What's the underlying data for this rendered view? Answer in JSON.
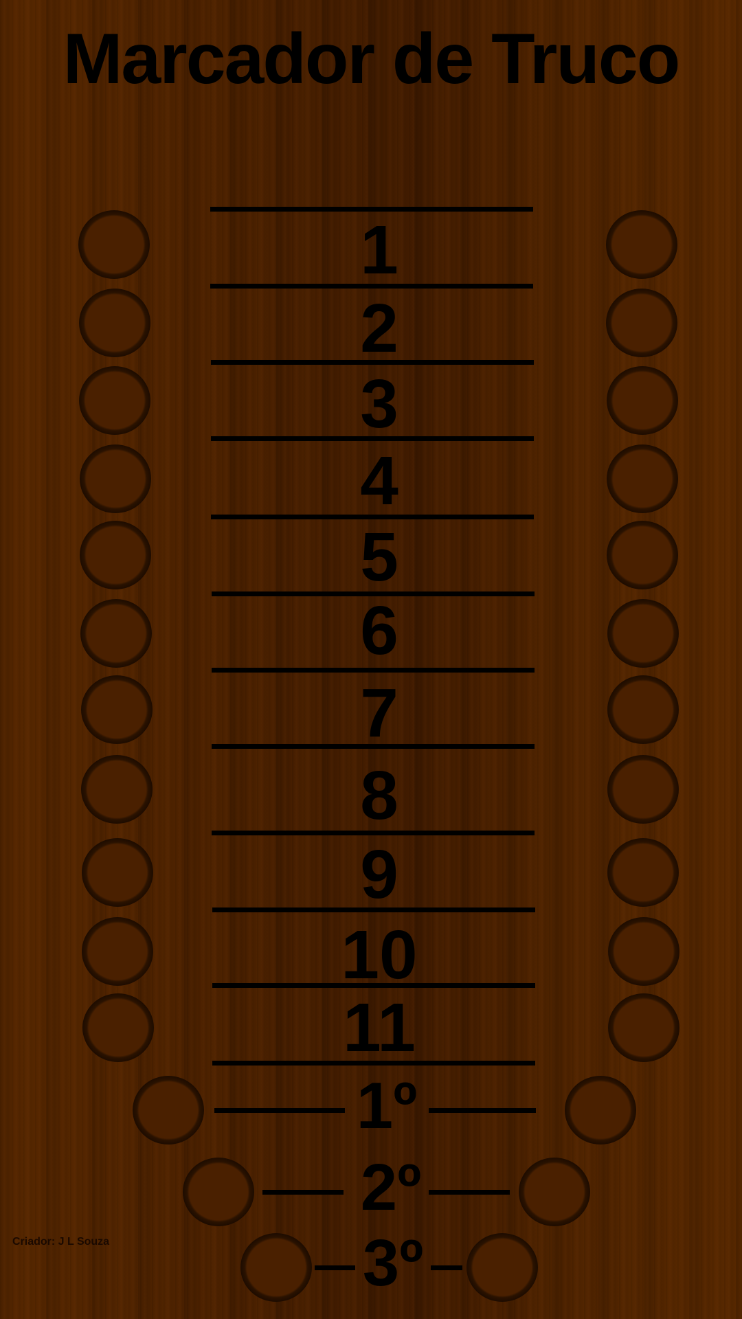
{
  "title": "Marcador de Truco",
  "score_rows": [
    "1",
    "2",
    "3",
    "4",
    "5",
    "6",
    "7",
    "8",
    "9",
    "10",
    "11"
  ],
  "places": [
    "1º",
    "2º",
    "3º"
  ],
  "credit": "Criador: J L Souza",
  "colors": {
    "wood": "#4f2300",
    "ink": "#000000"
  }
}
